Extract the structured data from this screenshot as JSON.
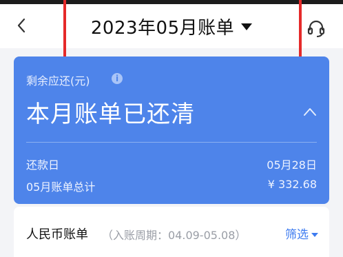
{
  "header": {
    "title": "2023年05月账单"
  },
  "summary": {
    "label": "剩余应还(元)",
    "info_glyph": "i",
    "status": "本月账单已还清",
    "due_label": "还款日",
    "due_value": "05月28日",
    "total_label": "05月账单总计",
    "total_value": "¥ 332.68"
  },
  "bill": {
    "title": "人民币账单",
    "period": "（入账周期：04.09-05.08）",
    "filter_label": "筛选"
  },
  "colors": {
    "card": "#4e84ea",
    "accent": "#3d7bf0",
    "highlight": "#e52a2a"
  }
}
